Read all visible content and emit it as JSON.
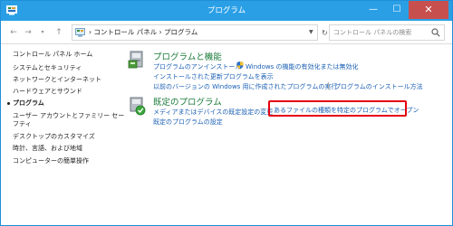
{
  "window": {
    "title": "プログラム",
    "buttons": {
      "minimize": "—",
      "maximize": "☐",
      "close": "✕"
    }
  },
  "address": {
    "path": "›  コントロール パネル  ›  プログラム",
    "search_placeholder": "コントロール パネルの検索"
  },
  "sidebar": {
    "home": "コントロール パネル ホーム",
    "items": [
      {
        "label": "システムとセキュリティ"
      },
      {
        "label": "ネットワークとインターネット"
      },
      {
        "label": "ハードウェアとサウンド"
      },
      {
        "label": "プログラム"
      },
      {
        "label": "ユーザー アカウントとファミリー セー"
      },
      {
        "label": "フティ"
      },
      {
        "label": "デスクトップのカスタマイズ"
      },
      {
        "label": "時計、言語、および地域"
      },
      {
        "label": "コンピューターの簡単操作"
      }
    ]
  },
  "categories": [
    {
      "title": "プログラムと機能",
      "links": {
        "uninstall": "プログラムのアンインストール",
        "features": "Windows の機能の有効化または無効化",
        "updates": "インストールされた更新プログラムを表示",
        "compat": "以前のバージョンの Windows 用に作成されたプログラムの実行",
        "howto": "プログラムのインストール方法"
      }
    },
    {
      "title": "既定のプログラム",
      "links": {
        "media": "メディアまたはデバイスの既定設定の変更",
        "filetype": "あるファイルの種類を特定のプログラムでオープン",
        "defaults": "既定のプログラムの設定"
      }
    }
  ],
  "colors": {
    "titlebar": "#2a9fe6",
    "link": "#1a5fb4",
    "category_title": "#1a7a3a",
    "highlight": "#e60012"
  }
}
